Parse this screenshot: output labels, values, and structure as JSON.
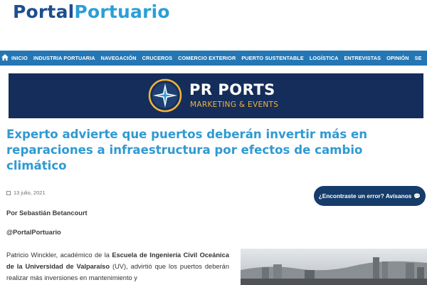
{
  "logo": {
    "part1": "Portal",
    "part2": "Portuario"
  },
  "nav": {
    "items": [
      "INICIO",
      "INDUSTRIA PORTUARIA",
      "NAVEGACIÓN",
      "CRUCEROS",
      "COMERCIO EXTERIOR",
      "PUERTO SUSTENTABLE",
      "LOGÍSTICA",
      "ENTREVISTAS",
      "OPINIÓN",
      "SE"
    ]
  },
  "banner": {
    "brand": "PR PORTS",
    "tagline": "MARKETING & EVENTS"
  },
  "article": {
    "title": "Experto advierte que puertos deberán invertir más en reparaciones a infraestructura por efectos de cambio climático",
    "date": "13 julio, 2021",
    "report_button": "¿Encontraste un error? Avísanos",
    "author": "Por Sebastián Betancourt",
    "handle": "@PortalPortuario",
    "p1_a": "Patricio Winckler, académico de la ",
    "p1_b": "Escuela de Ingeniería Civil Oceánica de la Universidad de Valparaíso",
    "p1_c": " (UV), advirtió que los puertos deberán realizar más inversiones en mantenimiento y"
  },
  "colors": {
    "nav": "#2477b4",
    "banner": "#152d5a",
    "title": "#2f9ad2",
    "accent": "#f0b43a"
  }
}
